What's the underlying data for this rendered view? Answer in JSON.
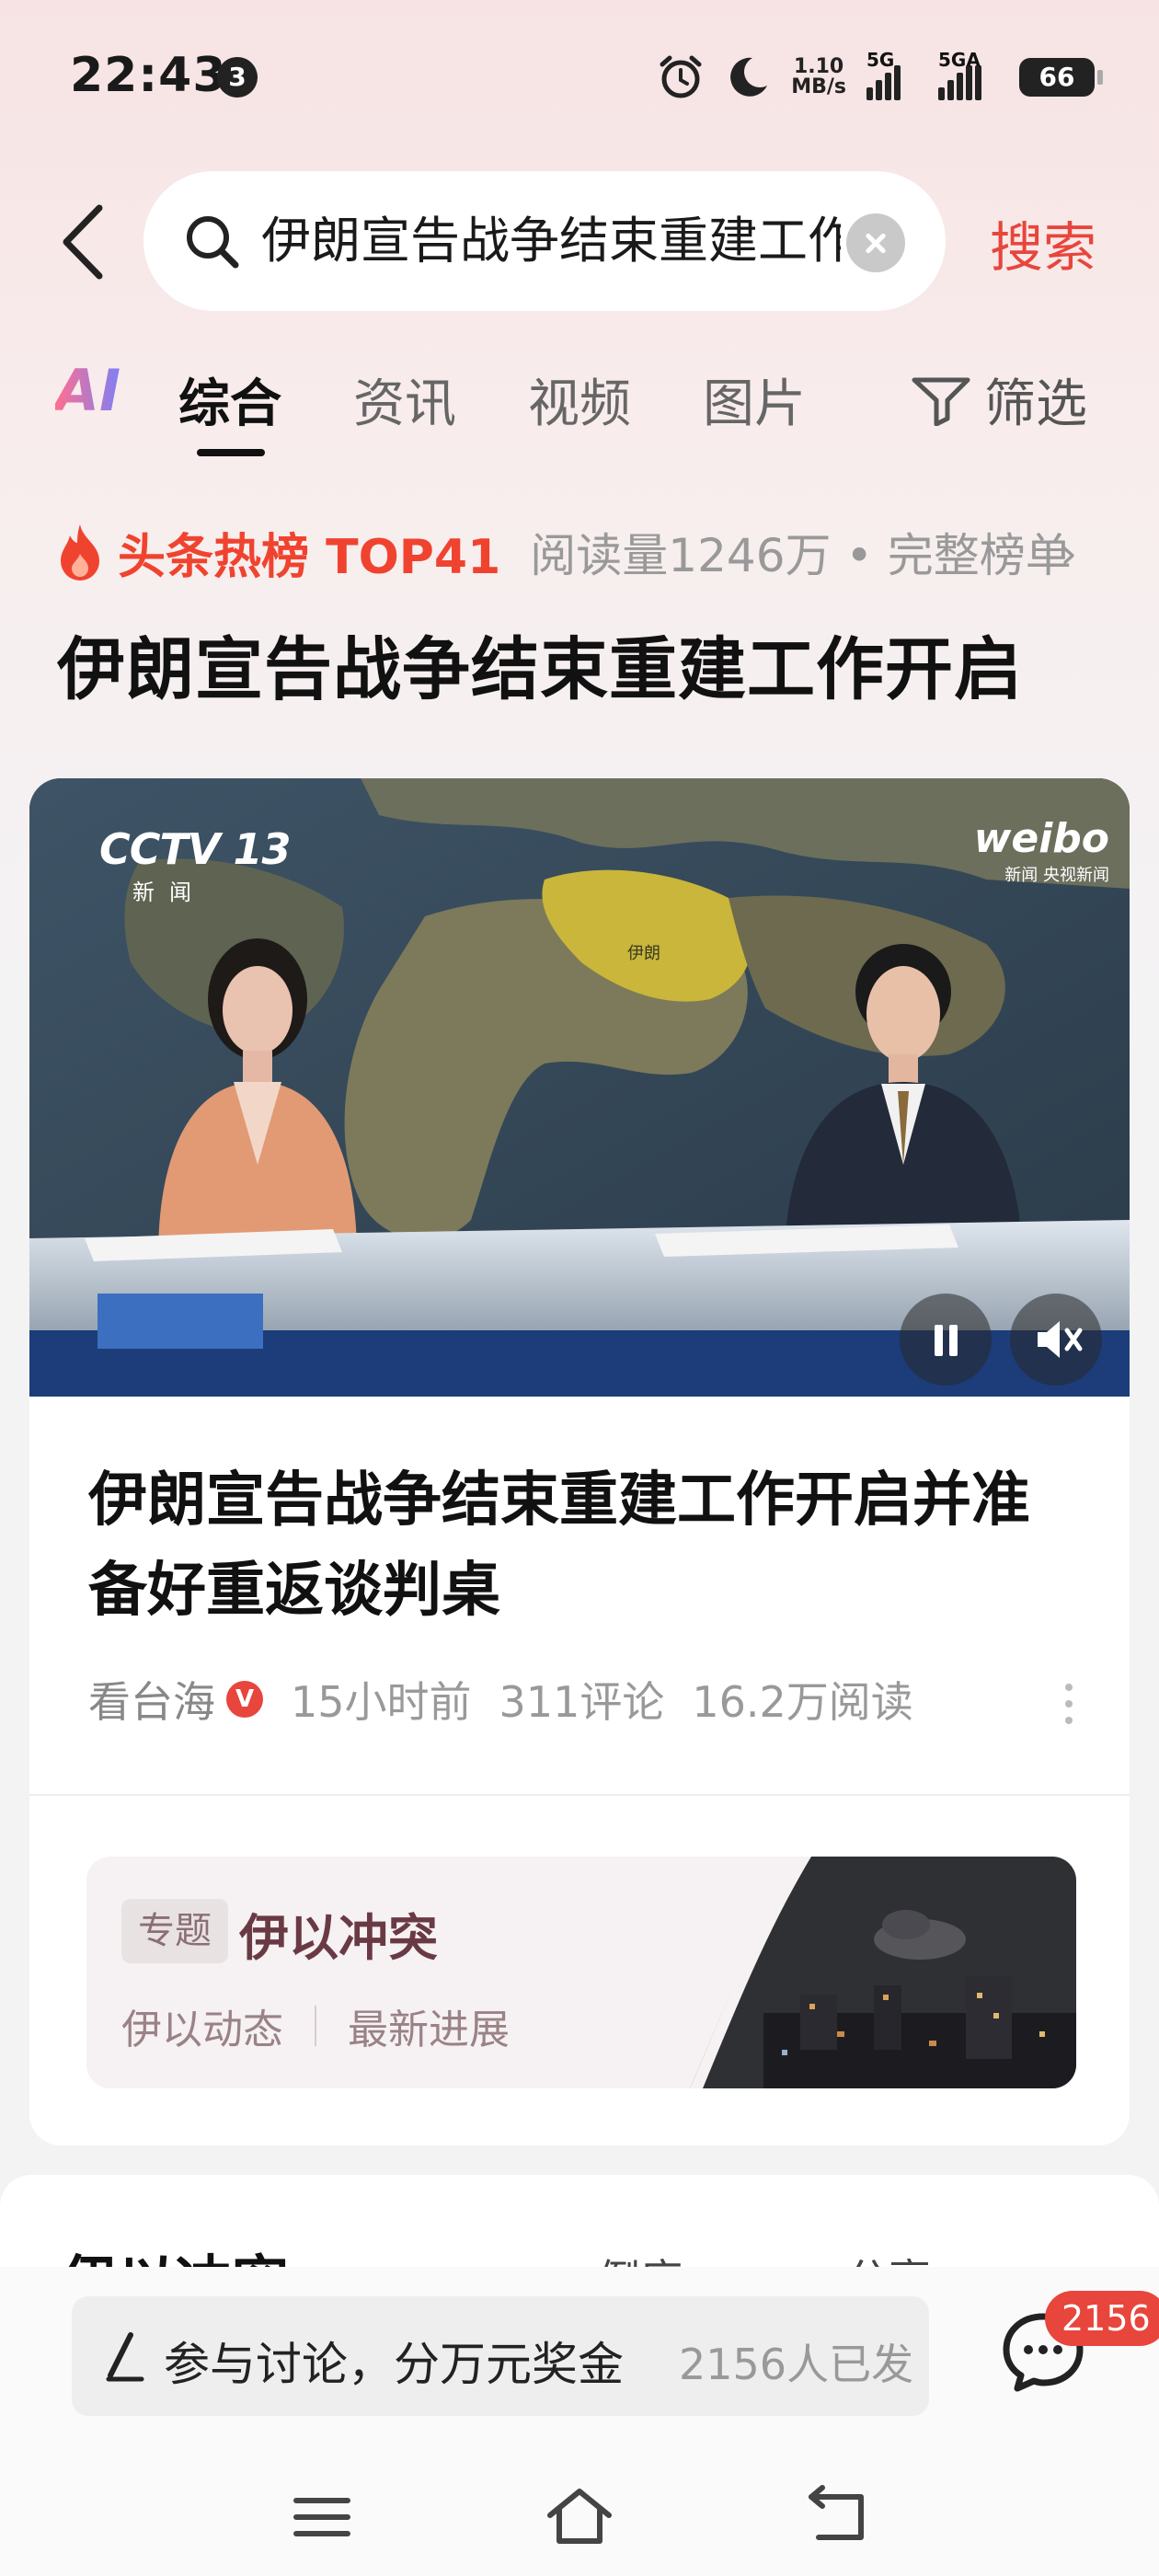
{
  "status_bar": {
    "time": "22:43",
    "notification_count": "3",
    "net_speed_value": "1.10",
    "net_speed_unit": "MB/s",
    "sim1_label": "5G",
    "sim2_label": "5GA",
    "battery": "66",
    "icons": [
      "alarm-icon",
      "moon-icon",
      "signal-icon",
      "signal-icon",
      "battery-icon"
    ]
  },
  "search": {
    "back_icon": "chevron-left-icon",
    "search_icon": "search-icon",
    "query": "伊朗宣告战争结束重建工作开启",
    "clear_icon": "clear-icon",
    "submit_label": "搜索"
  },
  "tabs": {
    "ai_label": "AI",
    "items": [
      "综合",
      "资讯",
      "视频",
      "图片"
    ],
    "active_index": 0,
    "filter_label": "筛选",
    "filter_icon": "filter-icon"
  },
  "hot_rank": {
    "fire_icon": "fire-icon",
    "label": "头条热榜 TOP41",
    "meta": "阅读量1246万 • 完整榜单",
    "chevron_icon": "chevron-right-icon",
    "headline": "伊朗宣告战争结束重建工作开启"
  },
  "article": {
    "video": {
      "channel_logo": "CCTV 13",
      "channel_sub": "新闻",
      "watermark": "weibo",
      "watermark_sub": "新闻 央视新闻",
      "map_label": "伊朗",
      "controls": [
        "pause-icon",
        "mute-icon"
      ]
    },
    "title": "伊朗宣告战争结束重建工作开启并准备好重返谈判桌",
    "author": "看台海",
    "verified_badge": "V",
    "time": "15小时前",
    "comments": "311评论",
    "reads": "16.2万阅读",
    "more_icon": "more-vertical-icon"
  },
  "topic": {
    "tag": "专题",
    "title": "伊以冲突",
    "links": [
      "伊以动态",
      "最新进展"
    ]
  },
  "next_card": {
    "title": "伊以冲突",
    "sort_label": "倒序",
    "share_label": "分享"
  },
  "comment_bar": {
    "pen_icon": "pen-icon",
    "placeholder": "参与讨论，分万元奖金",
    "count_text": "2156人已发",
    "chat_icon": "chat-bubble-icon",
    "badge": "2156"
  },
  "nav": [
    "menu-icon",
    "home-icon",
    "back-icon"
  ],
  "colors": {
    "accent_red": "#e8453c",
    "hot_orange": "#f0432f",
    "topic_title": "#6a3a44"
  }
}
